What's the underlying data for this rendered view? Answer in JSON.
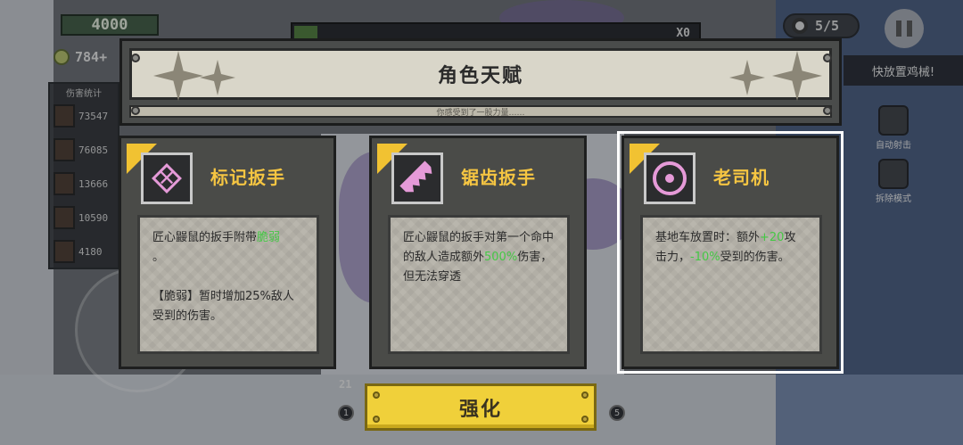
{
  "hud": {
    "gold": "4000",
    "resource": "784+",
    "damage_stats": {
      "title": "伤害统计",
      "values": [
        "73547",
        "76085",
        "13666",
        "10590",
        "4180"
      ]
    },
    "wave": "5/5",
    "hint_button": "快放置鸡械!",
    "auto_fire": "自动射击",
    "demolish": "拆除模式",
    "combo": "X0",
    "hotbar_left": "1",
    "hotbar_right": "5",
    "ammo": "21"
  },
  "modal": {
    "title": "角色天赋",
    "subtitle": "你感受到了一股力量……",
    "cards": [
      {
        "icon": "target-cross-icon",
        "title": "标记扳手",
        "desc_parts": [
          "匠心鼹鼠的扳手附带",
          "脆弱",
          "。",
          "【脆弱】暂时增加25%敌人受到的伤害。"
        ]
      },
      {
        "icon": "saw-blade-icon",
        "title": "锯齿扳手",
        "desc_parts": [
          "匠心鼹鼠的扳手对第一个命中的敌人造成额外",
          "500%",
          "伤害，但无法穿透"
        ]
      },
      {
        "icon": "steering-wheel-icon",
        "title": "老司机",
        "desc_parts": [
          "基地车放置时：额外",
          "+20",
          "攻击力，",
          "-10%",
          "受到的伤害。"
        ],
        "selected": true
      }
    ],
    "confirm_label": "强化"
  },
  "colors": {
    "title_gold": "#f5c542",
    "highlight_green": "#45c845",
    "button_yellow": "#f0d03a",
    "icon_pink": "#e59ad8"
  }
}
